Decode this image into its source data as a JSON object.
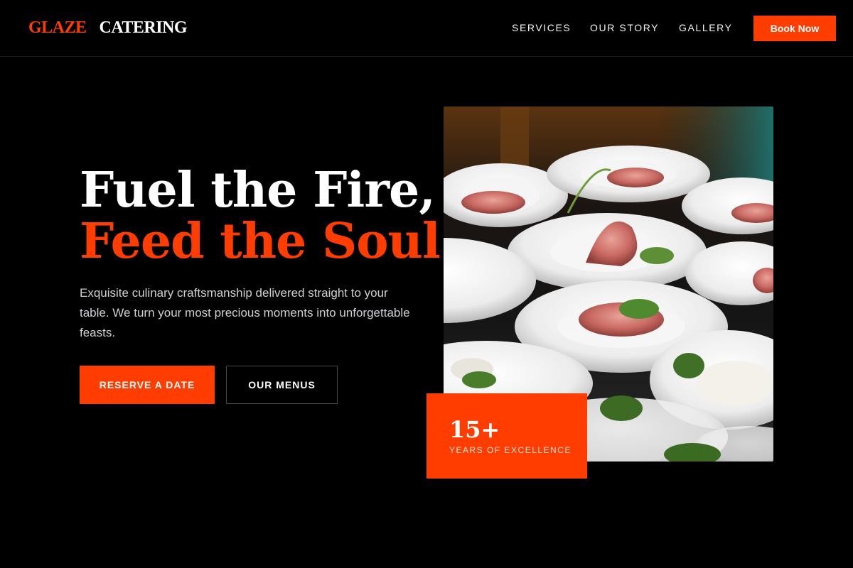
{
  "header": {
    "logo_brand": "GLAZE",
    "logo_sub": "CATERING",
    "nav": [
      "SERVICES",
      "OUR STORY",
      "GALLERY"
    ],
    "book_label": "Book Now"
  },
  "hero": {
    "title_line1": "Fuel the Fire,",
    "title_line2": "Feed the Soul.",
    "description": "Exquisite culinary craftsmanship delivered straight to your table. We turn your most precious moments into unforgettable feasts.",
    "primary_button": "RESERVE A DATE",
    "secondary_button": "OUR MENUS",
    "image_subject": "plated appetizers with prosciutto and greens",
    "badge": {
      "number": "15+",
      "label": "YEARS OF EXCELLENCE"
    }
  },
  "colors": {
    "accent": "#ff3d00",
    "background": "#000000",
    "text": "#ffffff",
    "muted_text": "#cfcfd4"
  }
}
